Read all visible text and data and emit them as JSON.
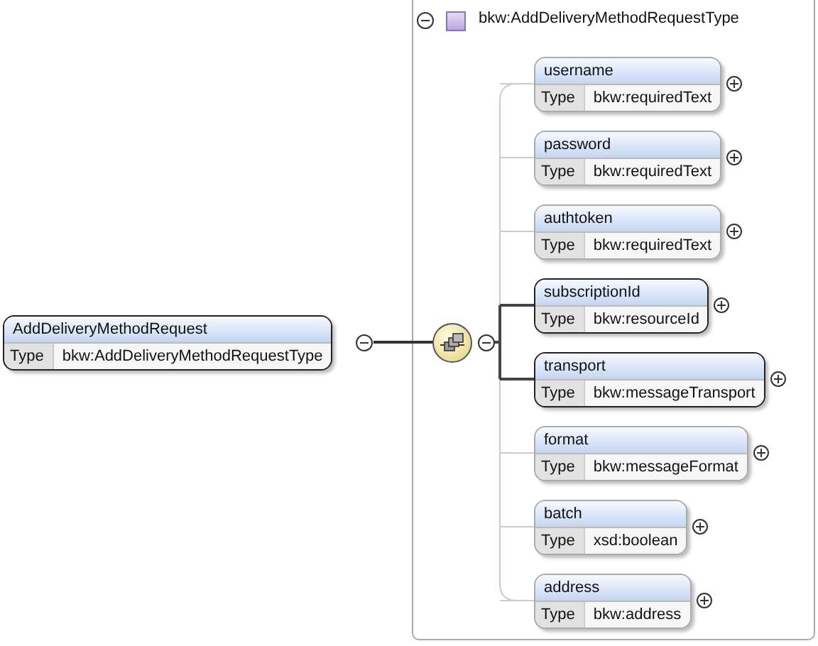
{
  "root": {
    "name": "AddDeliveryMethodRequest",
    "type_label": "Type",
    "type": "bkw:AddDeliveryMethodRequestType",
    "expanded": true
  },
  "complex_type": {
    "title": "bkw:AddDeliveryMethodRequestType",
    "expanded": true
  },
  "elements": [
    {
      "name": "username",
      "type_label": "Type",
      "type": "bkw:requiredText",
      "required": false,
      "expanded": false
    },
    {
      "name": "password",
      "type_label": "Type",
      "type": "bkw:requiredText",
      "required": false,
      "expanded": false
    },
    {
      "name": "authtoken",
      "type_label": "Type",
      "type": "bkw:requiredText",
      "required": false,
      "expanded": false
    },
    {
      "name": "subscriptionId",
      "type_label": "Type",
      "type": "bkw:resourceId",
      "required": true,
      "expanded": false
    },
    {
      "name": "transport",
      "type_label": "Type",
      "type": "bkw:messageTransport",
      "required": true,
      "expanded": false
    },
    {
      "name": "format",
      "type_label": "Type",
      "type": "bkw:messageFormat",
      "required": false,
      "expanded": false
    },
    {
      "name": "batch",
      "type_label": "Type",
      "type": "xsd:boolean",
      "required": false,
      "expanded": false
    },
    {
      "name": "address",
      "type_label": "Type",
      "type": "bkw:address",
      "required": false,
      "expanded": false
    }
  ]
}
